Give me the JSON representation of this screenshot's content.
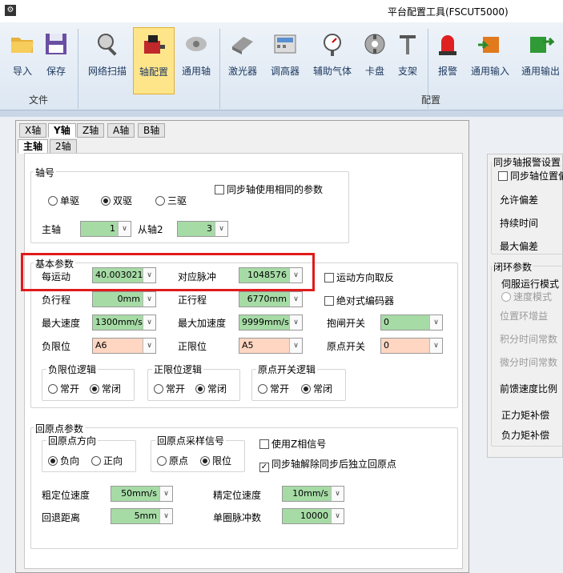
{
  "window": {
    "title": "平台配置工具(FSCUT5000)"
  },
  "ribbon": {
    "buttons": [
      {
        "label": "导入"
      },
      {
        "label": "保存"
      },
      {
        "label": "网络扫描"
      },
      {
        "label": "轴配置"
      },
      {
        "label": "通用轴"
      },
      {
        "label": "激光器"
      },
      {
        "label": "调高器"
      },
      {
        "label": "辅助气体"
      },
      {
        "label": "卡盘"
      },
      {
        "label": "支架"
      },
      {
        "label": "报警"
      },
      {
        "label": "通用输入"
      },
      {
        "label": "通用输出"
      }
    ],
    "groups": {
      "file": "文件",
      "config": "配置"
    }
  },
  "axis_tabs": [
    "X轴",
    "Y轴",
    "Z轴",
    "A轴",
    "B轴"
  ],
  "sub_tabs": [
    "主轴",
    "2轴"
  ],
  "axis_no": {
    "title": "轴号",
    "single": "单驱",
    "dual": "双驱",
    "triple": "三驱",
    "same_params": "同步轴使用相同的参数",
    "main_axis_label": "主轴",
    "main_axis_value": "1",
    "slave_label": "从轴2",
    "slave_value": "3"
  },
  "basic": {
    "title": "基本参数",
    "per_motion_label": "每运动",
    "per_motion_value": "40.003021mm",
    "pulse_label": "对应脉冲",
    "pulse_value": "1048576",
    "reverse_dir": "运动方向取反",
    "neg_travel_label": "负行程",
    "neg_travel_value": "0mm",
    "pos_travel_label": "正行程",
    "pos_travel_value": "6770mm",
    "abs_encoder": "绝对式编码器",
    "max_speed_label": "最大速度",
    "max_speed_value": "1300mm/s",
    "max_acc_label": "最大加速度",
    "max_acc_value": "9999mm/s²",
    "brake_label": "抱闸开关",
    "brake_value": "0",
    "neg_limit_label": "负限位",
    "neg_limit_value": "A6",
    "pos_limit_label": "正限位",
    "pos_limit_value": "A5",
    "origin_switch_label": "原点开关",
    "origin_switch_value": "0",
    "neg_logic_title": "负限位逻辑",
    "pos_logic_title": "正限位逻辑",
    "origin_logic_title": "原点开关逻辑",
    "no": "常开",
    "nc": "常闭"
  },
  "homing": {
    "title": "回原点参数",
    "dir_title": "回原点方向",
    "neg": "负向",
    "pos": "正向",
    "signal_title": "回原点采样信号",
    "origin": "原点",
    "limit": "限位",
    "use_z": "使用Z相信号",
    "sync_release": "同步轴解除同步后独立回原点",
    "coarse_speed_label": "粗定位速度",
    "coarse_speed_value": "50mm/s",
    "fine_speed_label": "精定位速度",
    "fine_speed_value": "10mm/s",
    "back_dist_label": "回退距离",
    "back_dist_value": "5mm",
    "pulses_label": "单圈脉冲数",
    "pulses_value": "10000"
  },
  "right": {
    "sync_alarm_title": "同步轴报警设置",
    "sync_pos_check": "同步轴位置偏",
    "allow_dev": "允许偏差",
    "duration": "持续时间",
    "max_dev": "最大偏差",
    "loop_title": "闭环参数",
    "servo_mode": "伺服运行模式",
    "speed_mode": "速度模式",
    "pos_gain": "位置环增益",
    "int_time": "积分时间常数",
    "diff_time": "微分时间常数",
    "ff_ratio": "前馈速度比例",
    "pos_torque": "正力矩补偿",
    "neg_torque": "负力矩补偿"
  }
}
